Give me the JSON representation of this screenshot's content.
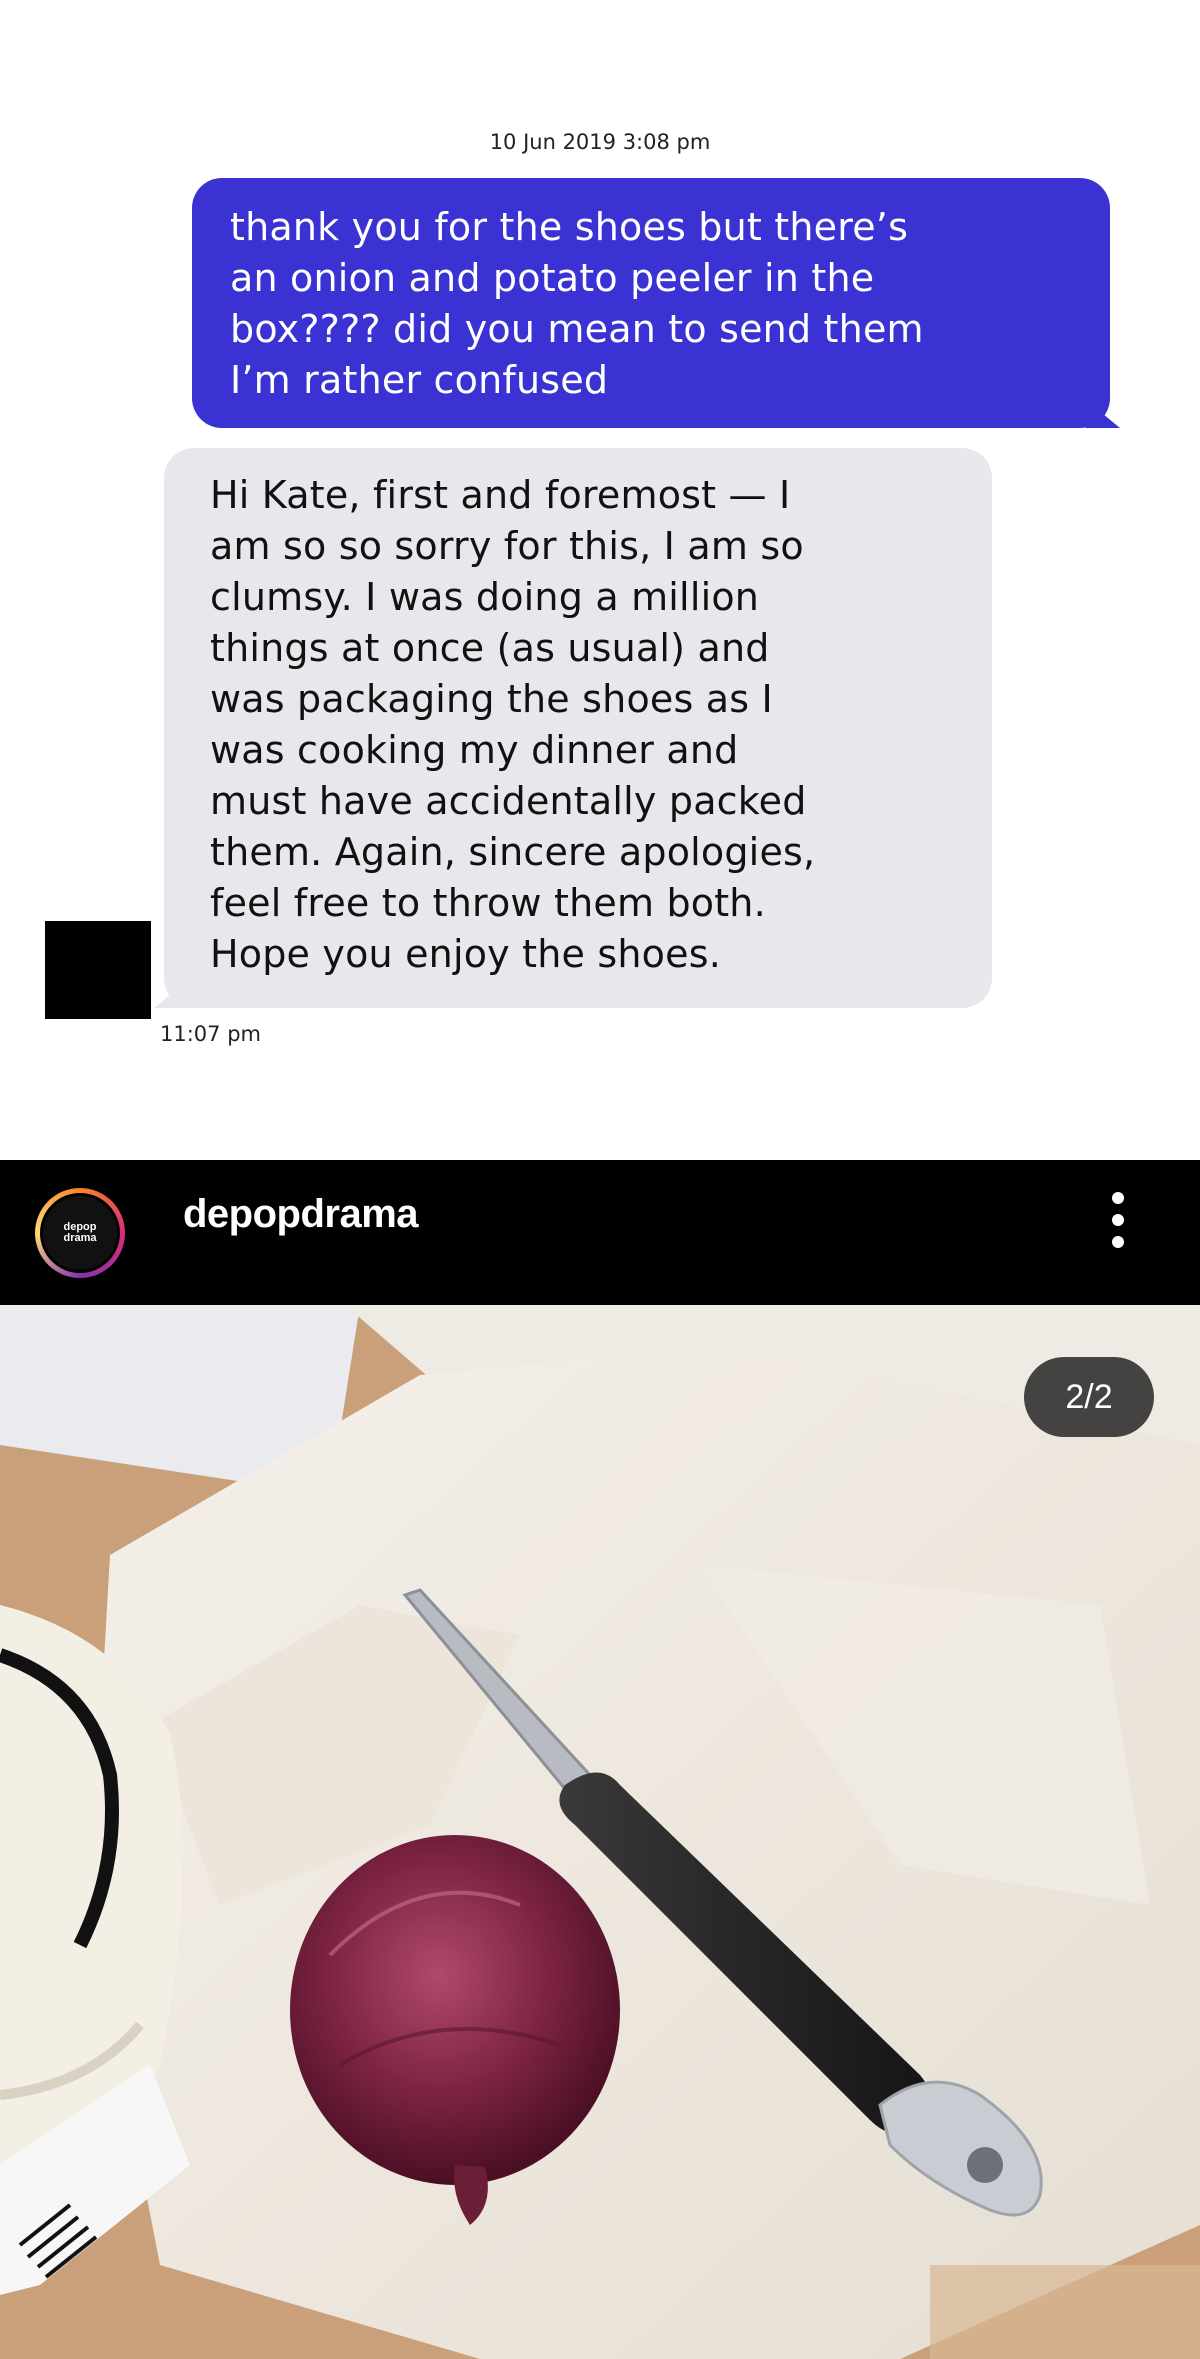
{
  "chat": {
    "timestamp_top": "10 Jun 2019 3:08 pm",
    "sent_message": {
      "lines": [
        "thank you for the shoes but there’s",
        "an onion and potato peeler in the",
        "box???? did you mean to send them",
        "I’m rather confused"
      ]
    },
    "received_message": {
      "lines": [
        "Hi Kate, first and foremost — I",
        "am so so sorry for this, I am so",
        "clumsy. I was doing a million",
        "things at once (as usual) and",
        "was packaging the shoes as I",
        "was cooking my dinner and",
        "must have accidentally packed",
        "them. Again, sincere apologies,",
        "feel free to throw them both.",
        "Hope you enjoy the shoes."
      ]
    },
    "timestamp_bottom": "11:07 pm"
  },
  "post": {
    "avatar_text_line1": "depop",
    "avatar_text_line2": "drama",
    "username": "depopdrama",
    "page_counter": "2/2",
    "icons": {
      "more": "more-vertical-icon"
    }
  },
  "colors": {
    "sent_bubble": "#3b32d4",
    "received_bubble": "#e7e7ec",
    "header_bg": "#000000"
  }
}
